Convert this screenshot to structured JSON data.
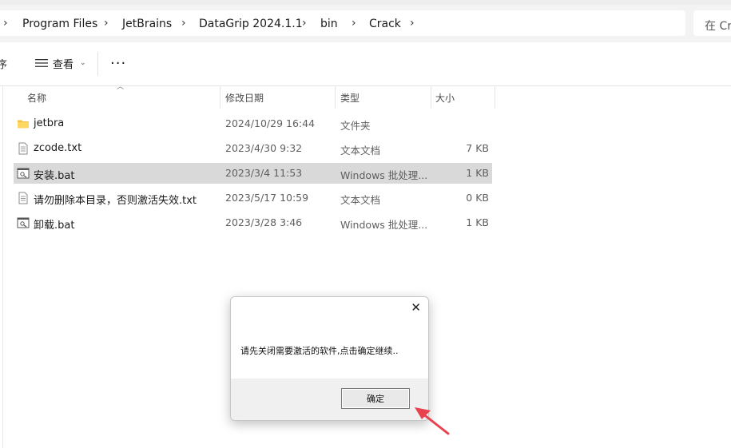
{
  "address_bar": {
    "crumbs": [
      "Program Files",
      "JetBrains",
      "DataGrip 2024.1.1",
      "bin",
      "Crack"
    ],
    "search_placeholder": "在 Crack"
  },
  "toolbar": {
    "clipped_label": "序",
    "view_label": "查看",
    "more_label": "..."
  },
  "columns": {
    "name": "名称",
    "date": "修改日期",
    "type": "类型",
    "size": "大小"
  },
  "files": [
    {
      "name": "jetbra",
      "date": "2024/10/29 16:44",
      "type": "文件夹",
      "size": "",
      "icon": "folder-icon"
    },
    {
      "name": "zcode.txt",
      "date": "2023/4/30 9:32",
      "type": "文本文档",
      "size": "7 KB",
      "icon": "text-file-icon"
    },
    {
      "name": "安装.bat",
      "date": "2023/3/4 11:53",
      "type": "Windows 批处理...",
      "size": "1 KB",
      "icon": "batch-file-icon",
      "selected": true
    },
    {
      "name": "请勿删除本目录，否则激活失效.txt",
      "date": "2023/5/17 10:59",
      "type": "文本文档",
      "size": "0 KB",
      "icon": "text-file-icon"
    },
    {
      "name": "卸载.bat",
      "date": "2023/3/28 3:46",
      "type": "Windows 批处理...",
      "size": "1 KB",
      "icon": "batch-file-icon"
    }
  ],
  "dialog": {
    "close_glyph": "✕",
    "message": "请先关闭需要激活的软件,点击确定继续..",
    "ok_label": "确定"
  },
  "colors": {
    "folder": "#f5c144",
    "selection": "#d9d9d9",
    "arrow": "#e8424f"
  }
}
